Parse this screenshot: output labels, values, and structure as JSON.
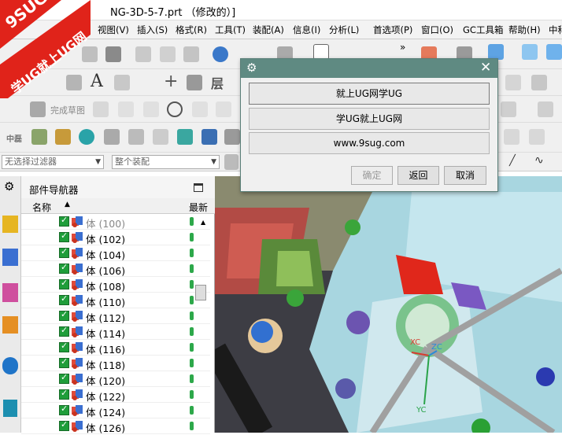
{
  "window": {
    "title": "NG-3D-5-7.prt （修改的）]"
  },
  "watermark": {
    "brand": "9SUG",
    "slogan": "学UG就上UG网"
  },
  "menu": {
    "items": [
      {
        "label": "视图(V)"
      },
      {
        "label": "插入(S)"
      },
      {
        "label": "格式(R)"
      },
      {
        "label": "工具(T)"
      },
      {
        "label": "装配(A)"
      },
      {
        "label": "信息(I)"
      },
      {
        "label": "分析(L)"
      },
      {
        "label": "首选项(P)"
      },
      {
        "label": "窗口(O)"
      },
      {
        "label": "GC工具箱"
      },
      {
        "label": "帮助(H)"
      },
      {
        "label": "中科"
      }
    ]
  },
  "toolbar": {
    "finish_sketch": "完成草图",
    "mold_label": "中磊"
  },
  "filters": {
    "selection_filter": "无选择过滤器",
    "scope": "整个装配"
  },
  "navigator": {
    "title": "部件导航器",
    "columns": {
      "name": "名称",
      "latest": "最新"
    },
    "rows": [
      {
        "label": "体 (100)"
      },
      {
        "label": "体 (102)"
      },
      {
        "label": "体 (104)"
      },
      {
        "label": "体 (106)"
      },
      {
        "label": "体 (108)"
      },
      {
        "label": "体 (110)"
      },
      {
        "label": "体 (112)"
      },
      {
        "label": "体 (114)"
      },
      {
        "label": "体 (116)"
      },
      {
        "label": "体 (118)"
      },
      {
        "label": "体 (120)"
      },
      {
        "label": "体 (122)"
      },
      {
        "label": "体 (124)"
      },
      {
        "label": "体 (126)"
      }
    ]
  },
  "dialog": {
    "options": [
      "就上UG网学UG",
      "学UG就上UG网",
      "www.9sug.com"
    ],
    "ok": "确定",
    "back": "返回",
    "cancel": "取消"
  },
  "canvas": {
    "axes": {
      "xc": "XC",
      "zc": "ZC",
      "yc": "YC"
    }
  },
  "colors": {
    "dialog_title": "#5f8a82",
    "watermark_red": "#e0231a",
    "check_green": "#1f9d3a"
  }
}
